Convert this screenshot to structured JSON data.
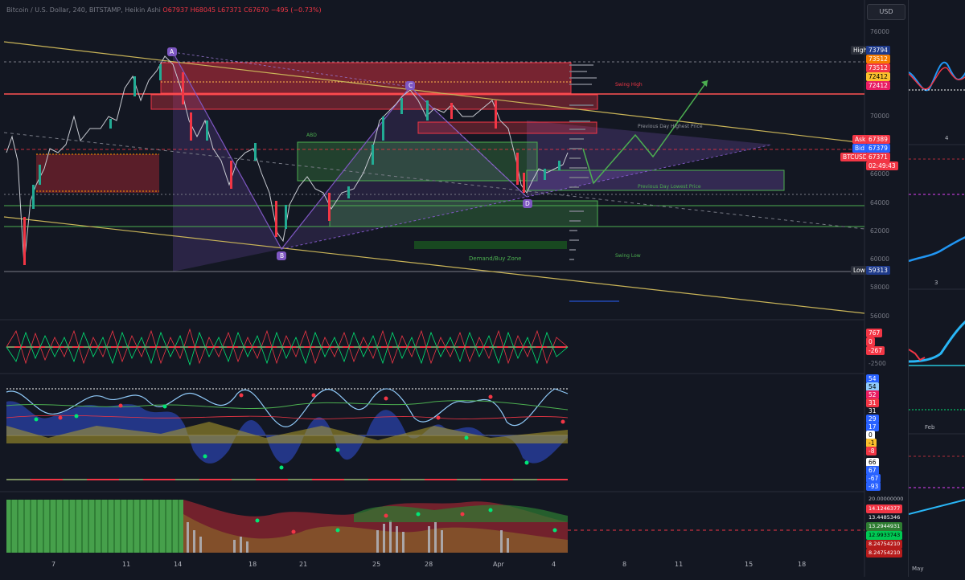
{
  "header": {
    "title": "Bitcoin / U.S. Dollar, 240, BITSTAMP, Heikin Ashi",
    "ohlc": "O67937 H68045 L67371 C67670 −495 (−0.73%)"
  },
  "currency_button": "USD",
  "price_axis": {
    "ticks": [
      "76000",
      "72000",
      "70000",
      "66000",
      "64000",
      "62000",
      "60000",
      "58000",
      "56000"
    ]
  },
  "price_tags": {
    "high_label": "High",
    "high_value": "73794",
    "t1": "73512",
    "t2": "73512",
    "t3": "72412",
    "t4": "72412",
    "ask_label": "Ask",
    "ask_value": "67389",
    "bid_label": "Bid",
    "bid_value": "67379",
    "sym_label": "BTCUSD",
    "sym_value": "67371",
    "countdown": "02:49:43",
    "low_label": "Low",
    "low_value": "59313"
  },
  "osc1_tags": [
    "767",
    "0",
    "-267",
    "-2500"
  ],
  "osc2_tags": [
    "54",
    "54",
    "52",
    "31",
    "31",
    "29",
    "17",
    "0",
    "-1",
    "-8",
    "66",
    "67",
    "-67",
    "-93"
  ],
  "osc3_tags": [
    "20.00000000",
    "14.1246377",
    "13.4485346",
    "13.2944931",
    "12.9933743",
    "8.24754210",
    "8.24754210"
  ],
  "x_axis": [
    "7",
    "11",
    "14",
    "18",
    "21",
    "25",
    "28",
    "Apr",
    "4",
    "8",
    "11",
    "15",
    "18"
  ],
  "annotations": {
    "point_a": "A",
    "point_b": "B",
    "point_c": "C",
    "point_d": "D",
    "demand_zone": "Demand/Buy Zone",
    "prev_day_high": "Previous Day Highest Price",
    "prev_day_low": "Previous Day Lowest Price",
    "swing_low": "Swing Low",
    "swing_high": "Swing High",
    "abd": "ABD"
  },
  "side_panel": {
    "labels": [
      "4",
      "3",
      "Feb",
      "May"
    ]
  },
  "colors": {
    "background": "#131722",
    "bull": "#22ab94",
    "bear": "#f23645",
    "harmonic": "#7e57c2",
    "trendline": "#c9b458",
    "hline": "#ff5252"
  }
}
